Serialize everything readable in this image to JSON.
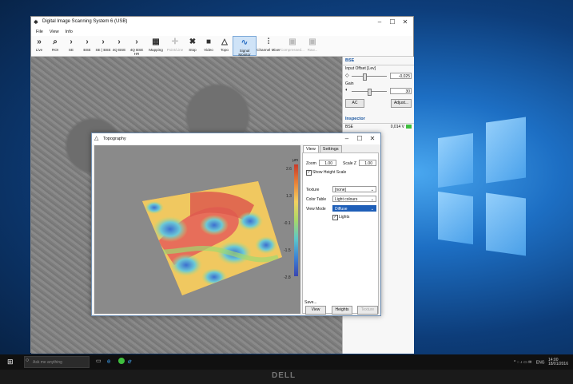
{
  "main_window": {
    "title": "Digital Image Scanning System 6 (USB)",
    "menu": [
      "File",
      "View",
      "Info"
    ],
    "toolbar": [
      {
        "label": "Live",
        "icon": "fast-forward-icon"
      },
      {
        "label": "ROI",
        "icon": "magnifier-icon"
      },
      {
        "label": "SE",
        "icon": "chevron-right-icon"
      },
      {
        "label": "BSE",
        "icon": "chevron-right-icon"
      },
      {
        "label": "SE | BSE",
        "icon": "chevron-right-icon"
      },
      {
        "label": "4Q BSE",
        "icon": "chevron-right-icon"
      },
      {
        "label": "4Q BSE HR",
        "icon": "chevron-right-icon"
      },
      {
        "label": "Mapping",
        "icon": "grid-icon"
      },
      {
        "label": "Point/Line",
        "icon": "crosshair-icon"
      },
      {
        "label": "Stop",
        "icon": "cross-icon"
      },
      {
        "label": "Video",
        "icon": "video-camera-icon"
      },
      {
        "label": "Topo",
        "icon": "triangle-icon"
      },
      {
        "label": "Signal Monitor",
        "icon": "waveform-icon"
      },
      {
        "label": "Channel Mixer",
        "icon": "mixer-icon"
      },
      {
        "label": "Compressed...",
        "icon": "save-icon"
      },
      {
        "label": "Raw...",
        "icon": "save-icon"
      }
    ]
  },
  "right_panel": {
    "section_bse": "BSE",
    "input_offset_label": "Input Offset [Lev]",
    "input_offset_value": "-0,025",
    "gain_label": "Gain",
    "gain_value": "30",
    "ac_button": "AC",
    "adjust_button": "Adjust...",
    "section_inspector": "Inspector",
    "inspector_channel": "BSE",
    "inspector_value": "0,014 V"
  },
  "topography": {
    "title": "Topography",
    "scale_unit": "µm",
    "scale_labels": [
      "2.6",
      "1.3",
      "-0.1",
      "-1.5",
      "-2.8"
    ],
    "tabs": [
      "View",
      "Settings"
    ],
    "zoom_label": "Zoom",
    "zoom_value": "1.00",
    "scalez_label": "Scale Z",
    "scalez_value": "1.00",
    "show_height_scale": "Show Height Scale",
    "texture_label": "Texture",
    "texture_value": "[none]",
    "color_table_label": "Color Table",
    "color_table_value": "Light colours",
    "view_mode_label": "View Mode",
    "view_mode_value": "Diffuse",
    "lights_label": "Lights",
    "save_label": "Save...",
    "btn_view": "View",
    "btn_heights": "Heights",
    "btn_texture": "Texture"
  },
  "taskbar": {
    "search_placeholder": "Ask me anything",
    "lang": "ENG",
    "time": "14:00",
    "date": "18/01/2016"
  },
  "monitor_brand": "DELL"
}
